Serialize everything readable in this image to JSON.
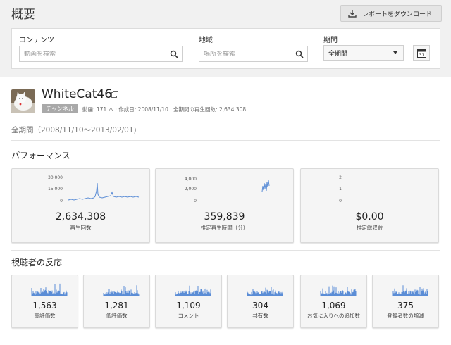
{
  "header": {
    "title": "概要",
    "download_label": "レポートをダウンロード"
  },
  "filters": {
    "content_label": "コンテンツ",
    "content_placeholder": "動画を検索",
    "region_label": "地域",
    "region_placeholder": "場所を検索",
    "period_label": "期間",
    "period_value": "全期間",
    "calendar_day": "31"
  },
  "channel": {
    "name": "WhiteCat46",
    "badge": "チャンネル",
    "meta": "動画: 171 本  ·  作成日: 2008/11/10  ·  全期間の再生回数: 2,634,308",
    "period": "全期間（2008/11/10〜2013/02/01)"
  },
  "performance": {
    "title": "パフォーマンス",
    "cards": [
      {
        "value": "2,634,308",
        "label": "再生回数",
        "ticks": [
          "30,000",
          "15,000",
          "0"
        ]
      },
      {
        "value": "359,839",
        "label": "推定再生時間（分）",
        "ticks": [
          "4,000",
          "2,000",
          "0"
        ]
      },
      {
        "value": "$0.00",
        "label": "推定総収益",
        "ticks": [
          "2",
          "1",
          "0"
        ]
      }
    ]
  },
  "audience": {
    "title": "視聴者の反応",
    "cards": [
      {
        "value": "1,563",
        "label": "高評価数"
      },
      {
        "value": "1,281",
        "label": "低評価数"
      },
      {
        "value": "1,109",
        "label": "コメント"
      },
      {
        "value": "304",
        "label": "共有数"
      },
      {
        "value": "1,069",
        "label": "お気に入りへの追加数"
      },
      {
        "value": "375",
        "label": "登録者数の増減"
      }
    ]
  },
  "colors": {
    "spark": "#5b8dd6",
    "spark_fill": "#a9c4ee",
    "badge_bg": "#a9a9a9"
  }
}
